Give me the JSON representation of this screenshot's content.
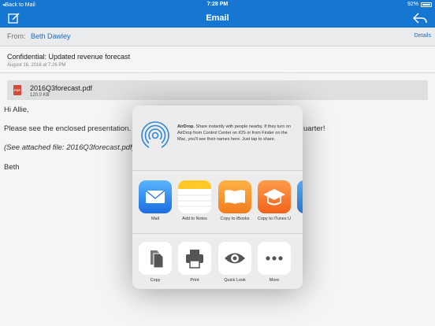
{
  "status_bar": {
    "back_text": "Back to Mail",
    "time": "7:28 PM",
    "battery": "92%"
  },
  "nav": {
    "title": "Email"
  },
  "email": {
    "from_label": "From:",
    "from_name": "Beth Dawley",
    "details_label": "Details",
    "subject": "Confidential: Updated revenue forecast",
    "date": "August 16, 2016 at 7:26 PM",
    "attachment": {
      "name": "2016Q3forecast.pdf",
      "size": "120.0 KB",
      "icon_label": "PDF"
    },
    "body": {
      "greeting": "Hi Allie,",
      "line1_start": "Please see the enclosed presentation. C",
      "line1_end": "uarter!",
      "attached_start": "(See attached file: 2016Q3forecast.pdf)",
      "signature": "Beth"
    }
  },
  "share_sheet": {
    "airdrop_title": "AirDrop",
    "airdrop_text": ". Share instantly with people nearby. If they turn on AirDrop from Control Center on iOS or from Finder on the Mac, you'll see their names here. Just tap to share.",
    "apps": [
      {
        "label": "Mail",
        "icon": "mail-icon"
      },
      {
        "label": "Add to Notes",
        "icon": "notes-icon"
      },
      {
        "label": "Copy to iBooks",
        "icon": "ibooks-icon"
      },
      {
        "label": "Copy to iTunes U",
        "icon": "itunes-u-icon"
      }
    ],
    "actions": [
      {
        "label": "Copy",
        "icon": "copy-icon"
      },
      {
        "label": "Print",
        "icon": "print-icon"
      },
      {
        "label": "Quick Look",
        "icon": "eye-icon"
      },
      {
        "label": "More",
        "icon": "more-icon"
      }
    ]
  },
  "colors": {
    "brand_blue": "#1677d2",
    "link_blue": "#1a73cf",
    "sheet_bg": "#ececec"
  }
}
